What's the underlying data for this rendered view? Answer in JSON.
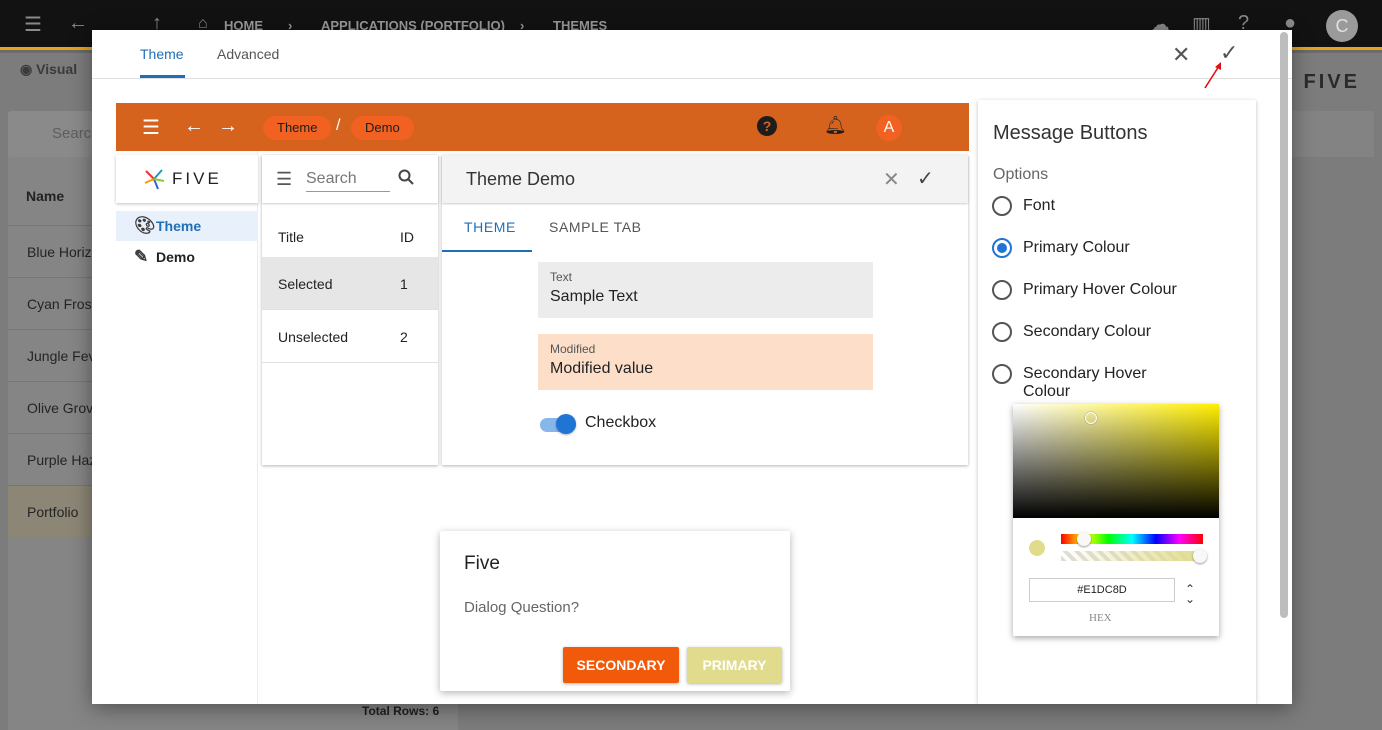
{
  "background": {
    "breadcrumb": [
      "HOME",
      "APPLICATIONS (PORTFOLIO)",
      "THEMES"
    ],
    "avatar": "C",
    "visual_label": "Visual",
    "search_placeholder": "Search",
    "column_name": "Name",
    "rows": [
      "Blue Horiz",
      "Cyan Frost",
      "Jungle Fev",
      "Olive Grov",
      "Purple Haz",
      "Portfolio"
    ],
    "total_rows": "Total Rows: 6",
    "logo_text": "FIVE"
  },
  "modal": {
    "tabs": [
      "Theme",
      "Advanced"
    ],
    "close_glyph": "✕",
    "confirm_glyph": "✓"
  },
  "preview": {
    "header": {
      "chips": [
        "Theme",
        "Demo"
      ],
      "slash": "/",
      "help_glyph": "?",
      "avatar": "A",
      "color": "#d5621d"
    },
    "logo_text": "FIVE",
    "menu": [
      {
        "label": "Theme",
        "icon": "palette-icon"
      },
      {
        "label": "Demo",
        "icon": "eyedropper-icon"
      }
    ],
    "list": {
      "search_placeholder": "Search",
      "header": {
        "title": "Title",
        "id": "ID"
      },
      "rows": [
        {
          "title": "Selected",
          "id": "1"
        },
        {
          "title": "Unselected",
          "id": "2"
        }
      ]
    },
    "form": {
      "title": "Theme Demo",
      "tabs": [
        "THEME",
        "SAMPLE TAB"
      ],
      "fields": [
        {
          "label": "Text",
          "value": "Sample Text"
        },
        {
          "label": "Modified",
          "value": "Modified value"
        }
      ],
      "checkbox_label": "Checkbox",
      "checkbox_on": true
    },
    "dialog": {
      "title": "Five",
      "question": "Dialog Question?",
      "secondary": "SECONDARY",
      "primary": "PRIMARY",
      "secondary_color": "#f15a0a",
      "primary_color": "#e1dc8d"
    }
  },
  "panel": {
    "title": "Message Buttons",
    "options_label": "Options",
    "options": [
      {
        "label": "Font",
        "checked": false
      },
      {
        "label": "Primary Colour",
        "checked": true
      },
      {
        "label": "Primary Hover Colour",
        "checked": false
      },
      {
        "label": "Secondary Colour",
        "checked": false
      },
      {
        "label": "Secondary Hover Colour",
        "checked": false
      }
    ],
    "picker": {
      "hex": "#E1DC8D",
      "hex_label": "HEX"
    }
  }
}
